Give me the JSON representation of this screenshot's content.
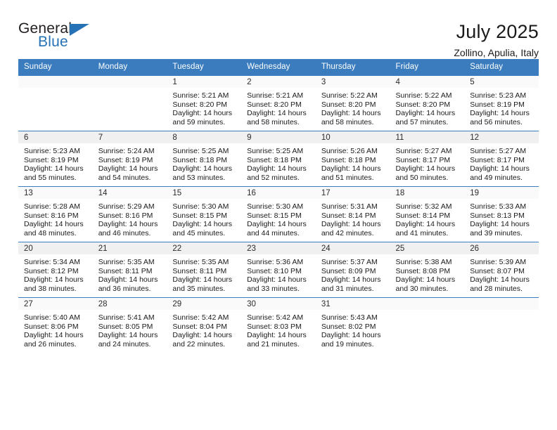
{
  "logo": {
    "word_top": "General",
    "word_bottom": "Blue",
    "triangle_color": "#2572b6"
  },
  "header": {
    "title": "July 2025",
    "subtitle": "Zollino, Apulia, Italy"
  },
  "theme": {
    "header_blue": "#3a7cbe",
    "daynum_strip": "#f0f0f0",
    "text": "#1a1a1a"
  },
  "weekday_headers": [
    "Sunday",
    "Monday",
    "Tuesday",
    "Wednesday",
    "Thursday",
    "Friday",
    "Saturday"
  ],
  "weeks": [
    [
      {
        "day": "",
        "sunrise": "",
        "sunset": "",
        "daylight_line1": "",
        "daylight_line2": ""
      },
      {
        "day": "",
        "sunrise": "",
        "sunset": "",
        "daylight_line1": "",
        "daylight_line2": ""
      },
      {
        "day": "1",
        "sunrise": "Sunrise: 5:21 AM",
        "sunset": "Sunset: 8:20 PM",
        "daylight_line1": "Daylight: 14 hours",
        "daylight_line2": "and 59 minutes."
      },
      {
        "day": "2",
        "sunrise": "Sunrise: 5:21 AM",
        "sunset": "Sunset: 8:20 PM",
        "daylight_line1": "Daylight: 14 hours",
        "daylight_line2": "and 58 minutes."
      },
      {
        "day": "3",
        "sunrise": "Sunrise: 5:22 AM",
        "sunset": "Sunset: 8:20 PM",
        "daylight_line1": "Daylight: 14 hours",
        "daylight_line2": "and 58 minutes."
      },
      {
        "day": "4",
        "sunrise": "Sunrise: 5:22 AM",
        "sunset": "Sunset: 8:20 PM",
        "daylight_line1": "Daylight: 14 hours",
        "daylight_line2": "and 57 minutes."
      },
      {
        "day": "5",
        "sunrise": "Sunrise: 5:23 AM",
        "sunset": "Sunset: 8:19 PM",
        "daylight_line1": "Daylight: 14 hours",
        "daylight_line2": "and 56 minutes."
      }
    ],
    [
      {
        "day": "6",
        "sunrise": "Sunrise: 5:23 AM",
        "sunset": "Sunset: 8:19 PM",
        "daylight_line1": "Daylight: 14 hours",
        "daylight_line2": "and 55 minutes."
      },
      {
        "day": "7",
        "sunrise": "Sunrise: 5:24 AM",
        "sunset": "Sunset: 8:19 PM",
        "daylight_line1": "Daylight: 14 hours",
        "daylight_line2": "and 54 minutes."
      },
      {
        "day": "8",
        "sunrise": "Sunrise: 5:25 AM",
        "sunset": "Sunset: 8:18 PM",
        "daylight_line1": "Daylight: 14 hours",
        "daylight_line2": "and 53 minutes."
      },
      {
        "day": "9",
        "sunrise": "Sunrise: 5:25 AM",
        "sunset": "Sunset: 8:18 PM",
        "daylight_line1": "Daylight: 14 hours",
        "daylight_line2": "and 52 minutes."
      },
      {
        "day": "10",
        "sunrise": "Sunrise: 5:26 AM",
        "sunset": "Sunset: 8:18 PM",
        "daylight_line1": "Daylight: 14 hours",
        "daylight_line2": "and 51 minutes."
      },
      {
        "day": "11",
        "sunrise": "Sunrise: 5:27 AM",
        "sunset": "Sunset: 8:17 PM",
        "daylight_line1": "Daylight: 14 hours",
        "daylight_line2": "and 50 minutes."
      },
      {
        "day": "12",
        "sunrise": "Sunrise: 5:27 AM",
        "sunset": "Sunset: 8:17 PM",
        "daylight_line1": "Daylight: 14 hours",
        "daylight_line2": "and 49 minutes."
      }
    ],
    [
      {
        "day": "13",
        "sunrise": "Sunrise: 5:28 AM",
        "sunset": "Sunset: 8:16 PM",
        "daylight_line1": "Daylight: 14 hours",
        "daylight_line2": "and 48 minutes."
      },
      {
        "day": "14",
        "sunrise": "Sunrise: 5:29 AM",
        "sunset": "Sunset: 8:16 PM",
        "daylight_line1": "Daylight: 14 hours",
        "daylight_line2": "and 46 minutes."
      },
      {
        "day": "15",
        "sunrise": "Sunrise: 5:30 AM",
        "sunset": "Sunset: 8:15 PM",
        "daylight_line1": "Daylight: 14 hours",
        "daylight_line2": "and 45 minutes."
      },
      {
        "day": "16",
        "sunrise": "Sunrise: 5:30 AM",
        "sunset": "Sunset: 8:15 PM",
        "daylight_line1": "Daylight: 14 hours",
        "daylight_line2": "and 44 minutes."
      },
      {
        "day": "17",
        "sunrise": "Sunrise: 5:31 AM",
        "sunset": "Sunset: 8:14 PM",
        "daylight_line1": "Daylight: 14 hours",
        "daylight_line2": "and 42 minutes."
      },
      {
        "day": "18",
        "sunrise": "Sunrise: 5:32 AM",
        "sunset": "Sunset: 8:14 PM",
        "daylight_line1": "Daylight: 14 hours",
        "daylight_line2": "and 41 minutes."
      },
      {
        "day": "19",
        "sunrise": "Sunrise: 5:33 AM",
        "sunset": "Sunset: 8:13 PM",
        "daylight_line1": "Daylight: 14 hours",
        "daylight_line2": "and 39 minutes."
      }
    ],
    [
      {
        "day": "20",
        "sunrise": "Sunrise: 5:34 AM",
        "sunset": "Sunset: 8:12 PM",
        "daylight_line1": "Daylight: 14 hours",
        "daylight_line2": "and 38 minutes."
      },
      {
        "day": "21",
        "sunrise": "Sunrise: 5:35 AM",
        "sunset": "Sunset: 8:11 PM",
        "daylight_line1": "Daylight: 14 hours",
        "daylight_line2": "and 36 minutes."
      },
      {
        "day": "22",
        "sunrise": "Sunrise: 5:35 AM",
        "sunset": "Sunset: 8:11 PM",
        "daylight_line1": "Daylight: 14 hours",
        "daylight_line2": "and 35 minutes."
      },
      {
        "day": "23",
        "sunrise": "Sunrise: 5:36 AM",
        "sunset": "Sunset: 8:10 PM",
        "daylight_line1": "Daylight: 14 hours",
        "daylight_line2": "and 33 minutes."
      },
      {
        "day": "24",
        "sunrise": "Sunrise: 5:37 AM",
        "sunset": "Sunset: 8:09 PM",
        "daylight_line1": "Daylight: 14 hours",
        "daylight_line2": "and 31 minutes."
      },
      {
        "day": "25",
        "sunrise": "Sunrise: 5:38 AM",
        "sunset": "Sunset: 8:08 PM",
        "daylight_line1": "Daylight: 14 hours",
        "daylight_line2": "and 30 minutes."
      },
      {
        "day": "26",
        "sunrise": "Sunrise: 5:39 AM",
        "sunset": "Sunset: 8:07 PM",
        "daylight_line1": "Daylight: 14 hours",
        "daylight_line2": "and 28 minutes."
      }
    ],
    [
      {
        "day": "27",
        "sunrise": "Sunrise: 5:40 AM",
        "sunset": "Sunset: 8:06 PM",
        "daylight_line1": "Daylight: 14 hours",
        "daylight_line2": "and 26 minutes."
      },
      {
        "day": "28",
        "sunrise": "Sunrise: 5:41 AM",
        "sunset": "Sunset: 8:05 PM",
        "daylight_line1": "Daylight: 14 hours",
        "daylight_line2": "and 24 minutes."
      },
      {
        "day": "29",
        "sunrise": "Sunrise: 5:42 AM",
        "sunset": "Sunset: 8:04 PM",
        "daylight_line1": "Daylight: 14 hours",
        "daylight_line2": "and 22 minutes."
      },
      {
        "day": "30",
        "sunrise": "Sunrise: 5:42 AM",
        "sunset": "Sunset: 8:03 PM",
        "daylight_line1": "Daylight: 14 hours",
        "daylight_line2": "and 21 minutes."
      },
      {
        "day": "31",
        "sunrise": "Sunrise: 5:43 AM",
        "sunset": "Sunset: 8:02 PM",
        "daylight_line1": "Daylight: 14 hours",
        "daylight_line2": "and 19 minutes."
      },
      {
        "day": "",
        "sunrise": "",
        "sunset": "",
        "daylight_line1": "",
        "daylight_line2": ""
      },
      {
        "day": "",
        "sunrise": "",
        "sunset": "",
        "daylight_line1": "",
        "daylight_line2": ""
      }
    ]
  ]
}
